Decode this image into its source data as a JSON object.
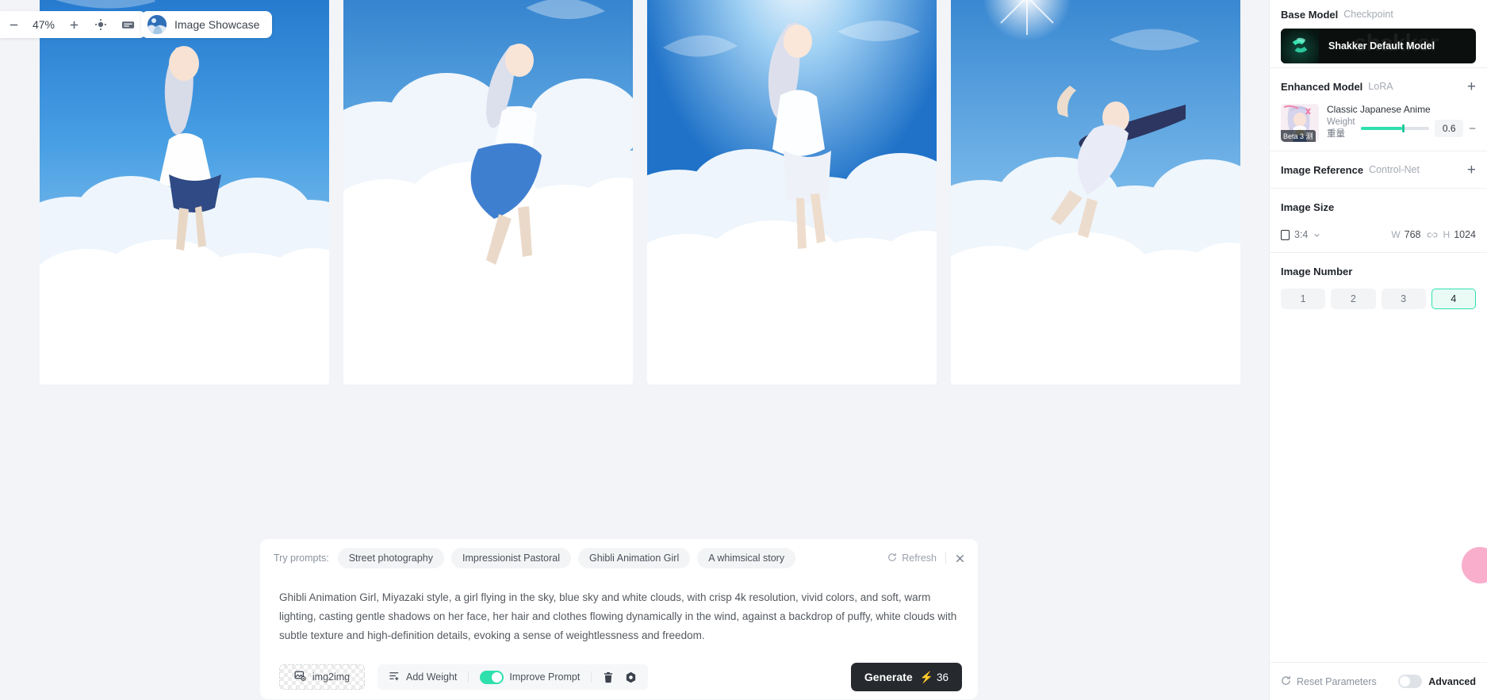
{
  "zoom_toolbar": {
    "minus_icon": "minus-icon",
    "percent": "47%",
    "plus_icon": "plus-icon",
    "target_icon": "target-icon",
    "frame_icon": "frame-icon"
  },
  "showcase_tab": {
    "label": "Image Showcase",
    "avatar_icon": "showcase-avatar"
  },
  "canvas": {
    "images": [
      {
        "alt": "anime girl in white and blue dress floating among clouds"
      },
      {
        "alt": "anime girl in blue ruffled dress reclining on clouds"
      },
      {
        "alt": "anime girl in white dress floating under bright sun"
      },
      {
        "alt": "anime girl with dark hair flying over clouds"
      }
    ]
  },
  "prompt_panel": {
    "try_label": "Try prompts:",
    "chips": [
      "Street photography",
      "Impressionist Pastoral",
      "Ghibli Animation Girl",
      "A whimsical story"
    ],
    "refresh_label": "Refresh",
    "refresh_icon": "refresh-icon",
    "close_icon": "close-icon",
    "prompt_text": "Ghibli Animation Girl, Miyazaki style, a girl flying in the sky, blue sky and white clouds, with crisp 4k resolution, vivid colors, and soft, warm lighting, casting gentle shadows on her face, her hair and clothes flowing dynamically in the wind, against a backdrop of puffy, white clouds with subtle texture and high-definition details, evoking a sense of weightlessness and freedom.",
    "img2img_label": "img2img",
    "img2img_icon": "image-upload-icon",
    "add_weight_label": "Add Weight",
    "add_weight_icon": "add-weight-icon",
    "improve_prompt_label": "Improve Prompt",
    "improve_prompt_on": true,
    "delete_icon": "trash-icon",
    "settings_icon": "settings-icon",
    "generate_label": "Generate",
    "generate_credits": "36",
    "credits_icon": "bolt-icon"
  },
  "sidebar": {
    "base_model": {
      "title": "Base Model",
      "subtitle": "Checkpoint",
      "card_name": "Shakker Default Model",
      "ghost_text": "shakker",
      "thumb_icon": "shakker-logo-icon"
    },
    "enhanced_model": {
      "title": "Enhanced Model",
      "subtitle": "LoRA",
      "add_icon": "plus-icon",
      "lora_name": "Classic Japanese Anime",
      "lora_badge": "Beta 3 测",
      "weight_label": "Weight",
      "weight_label_cn": "重量",
      "weight_value": "0.6",
      "weight_fraction": 0.6,
      "minus_icon": "minus-icon"
    },
    "image_reference": {
      "title": "Image Reference",
      "subtitle": "Control-Net",
      "add_icon": "plus-icon"
    },
    "image_size": {
      "title": "Image Size",
      "ratio": "3:4",
      "ratio_icon": "aspect-ratio-icon",
      "chevron_icon": "chevron-down-icon",
      "w_label": "W",
      "w_value": "768",
      "link_icon": "link-icon",
      "h_label": "H",
      "h_value": "1024"
    },
    "image_number": {
      "title": "Image Number",
      "options": [
        "1",
        "2",
        "3",
        "4"
      ],
      "selected": "4"
    },
    "footer": {
      "reset_label": "Reset Parameters",
      "reset_icon": "reset-icon",
      "advanced_label": "Advanced",
      "advanced_on": false
    }
  },
  "floating": {
    "bubble_name": "chat-bubble"
  },
  "colors": {
    "accent": "#2ee0ae",
    "generate_bg": "#26292e",
    "bolt": "#f2b345",
    "canvas_bg": "#f2f4f7",
    "bubble": "#f9aecb"
  }
}
